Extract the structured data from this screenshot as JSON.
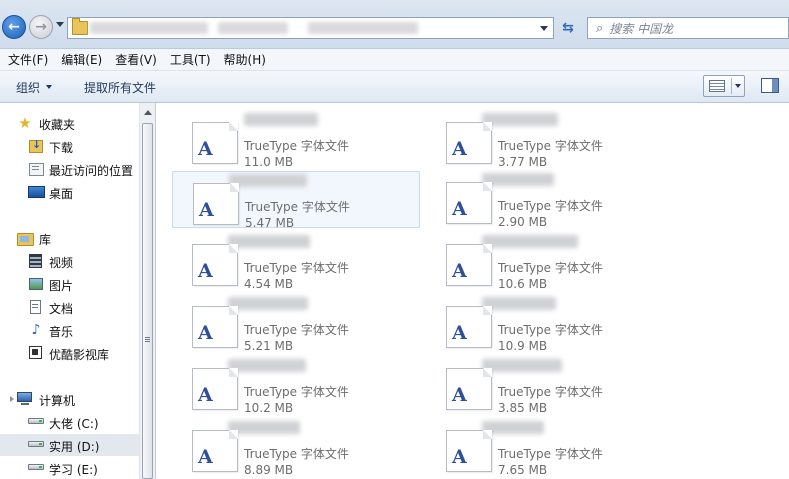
{
  "address": {
    "path": "",
    "search_placeholder": "搜索 中国龙"
  },
  "menu": [
    "文件(F)",
    "编辑(E)",
    "查看(V)",
    "工具(T)",
    "帮助(H)"
  ],
  "commands": {
    "organize": "组织",
    "extract_all": "提取所有文件"
  },
  "nav": {
    "favorites": "收藏夹",
    "downloads": "下载",
    "recent": "最近访问的位置",
    "desktop": "桌面",
    "libraries": "库",
    "videos": "视频",
    "pictures": "图片",
    "documents": "文档",
    "music": "音乐",
    "youku": "优酷影视库",
    "computer": "计算机",
    "drive_c": "大佬 (C:)",
    "drive_d": "实用 (D:)",
    "drive_e": "学习 (E:)"
  },
  "files": [
    {
      "type": "TrueType 字体文件",
      "size": "11.0 MB"
    },
    {
      "type": "TrueType 字体文件",
      "size": "3.77 MB"
    },
    {
      "type": "TrueType 字体文件",
      "size": "5.47 MB"
    },
    {
      "type": "TrueType 字体文件",
      "size": "2.90 MB"
    },
    {
      "type": "TrueType 字体文件",
      "size": "4.54 MB"
    },
    {
      "type": "TrueType 字体文件",
      "size": "10.6 MB"
    },
    {
      "type": "TrueType 字体文件",
      "size": "5.21 MB"
    },
    {
      "type": "TrueType 字体文件",
      "size": "10.9 MB"
    },
    {
      "type": "TrueType 字体文件",
      "size": "10.2 MB"
    },
    {
      "type": "TrueType 字体文件",
      "size": "3.85 MB"
    },
    {
      "type": "TrueType 字体文件",
      "size": "8.89 MB"
    },
    {
      "type": "TrueType 字体文件",
      "size": "7.65 MB"
    }
  ],
  "file_icon_glyph": "A",
  "colors": {
    "accent": "#1c5fb8",
    "selection": "#c7dcf2",
    "secondary_text": "#6d6d6d"
  }
}
